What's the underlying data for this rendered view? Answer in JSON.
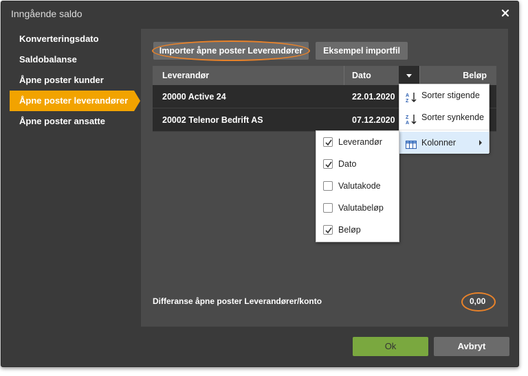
{
  "dialog": {
    "title": "Inngående saldo",
    "close_icon": "close-icon"
  },
  "nav": {
    "items": [
      {
        "label": "Konverteringsdato"
      },
      {
        "label": "Saldobalanse"
      },
      {
        "label": "Åpne poster kunder"
      },
      {
        "label": "Åpne poster leverandører"
      },
      {
        "label": "Åpne poster ansatte"
      }
    ],
    "active_index": 3
  },
  "toolbar": {
    "import_label": "Importer åpne poster Leverandører",
    "example_label": "Eksempel importfil"
  },
  "grid": {
    "columns": [
      "Leverandør",
      "Dato",
      "Beløp"
    ],
    "rows": [
      {
        "supplier": "20000 Active 24",
        "date": "22.01.2020"
      },
      {
        "supplier": "20002 Telenor Bedrift AS",
        "date": "07.12.2020"
      }
    ]
  },
  "column_menu": {
    "items": [
      {
        "label": "Sorter stigende",
        "icon": "sort-ascending-icon"
      },
      {
        "label": "Sorter synkende",
        "icon": "sort-descending-icon"
      },
      {
        "label": "Kolonner",
        "icon": "columns-icon"
      }
    ]
  },
  "columns_submenu": {
    "items": [
      {
        "label": "Leverandør",
        "checked": true
      },
      {
        "label": "Dato",
        "checked": true
      },
      {
        "label": "Valutakode",
        "checked": false
      },
      {
        "label": "Valutabeløp",
        "checked": false
      },
      {
        "label": "Beløp",
        "checked": true
      }
    ]
  },
  "footer": {
    "diff_label": "Differanse åpne poster Leverandører/konto",
    "diff_value": "0,00"
  },
  "actions": {
    "ok_label": "Ok",
    "cancel_label": "Avbryt"
  },
  "colors": {
    "accent": "#f2a300",
    "highlight": "#e8822a",
    "ok": "#7aa83f"
  }
}
